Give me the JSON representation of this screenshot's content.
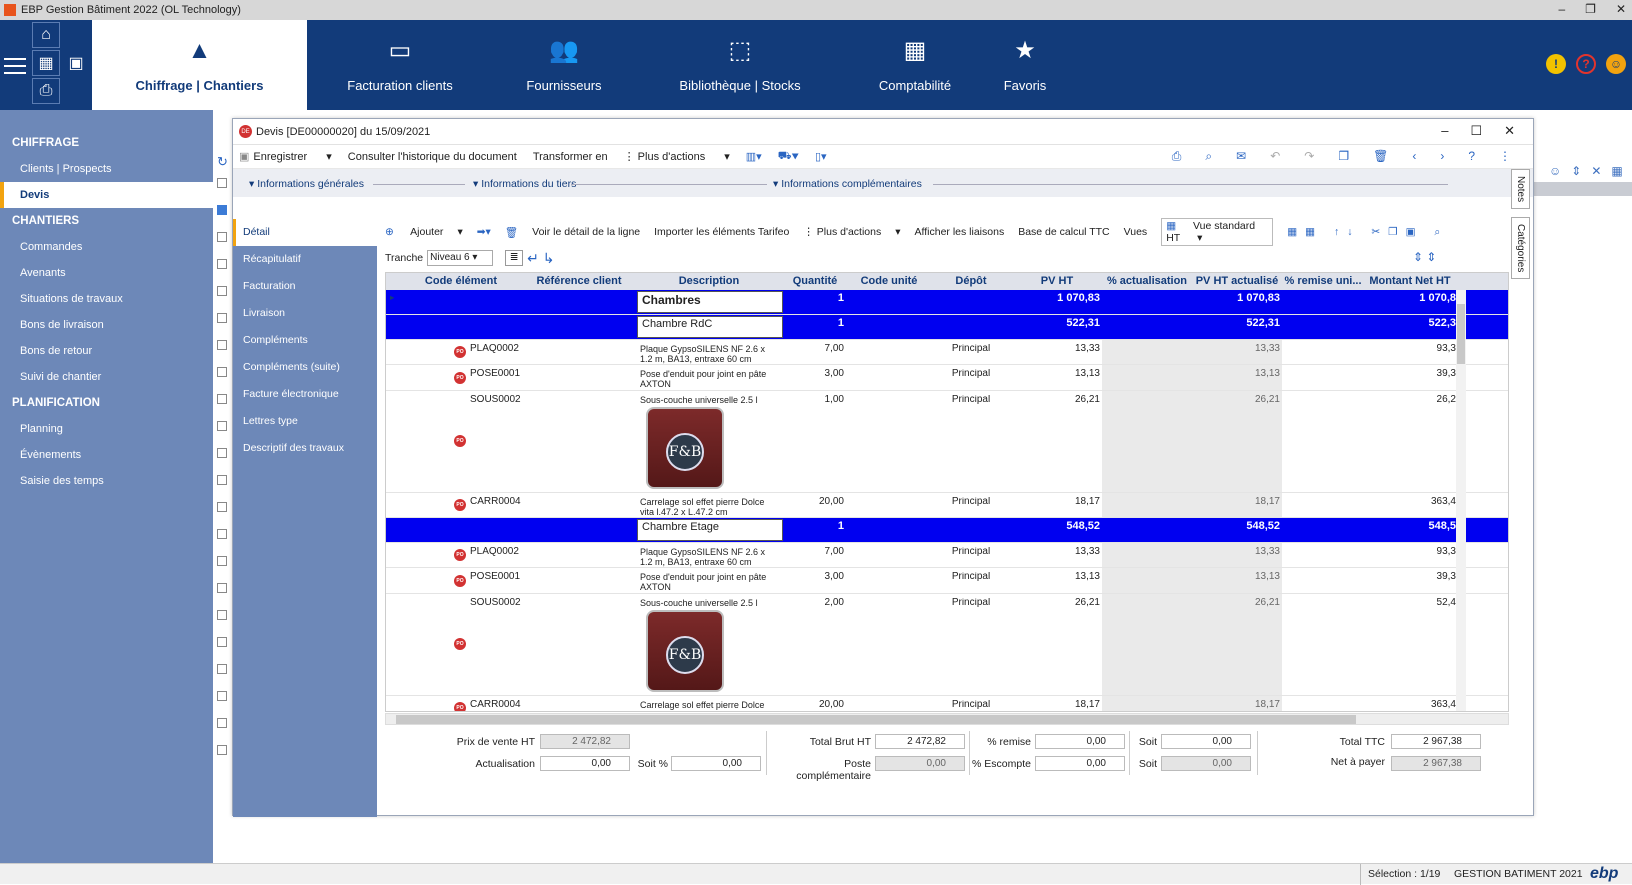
{
  "window": {
    "title": "EBP Gestion Bâtiment 2022 (OL Technology)"
  },
  "ribbon": {
    "tabs": [
      {
        "label": "Chiffrage | Chantiers",
        "icon": "cone-icon"
      },
      {
        "label": "Facturation clients",
        "icon": "card-icon"
      },
      {
        "label": "Fournisseurs",
        "icon": "users-icon"
      },
      {
        "label": "Bibliothèque | Stocks",
        "icon": "box-icon"
      },
      {
        "label": "Comptabilité",
        "icon": "calculator-icon"
      },
      {
        "label": "Favoris",
        "icon": "star-icon"
      }
    ]
  },
  "sidebar": {
    "sections": [
      {
        "title": "CHIFFRAGE",
        "items": [
          "Clients | Prospects",
          "Devis"
        ]
      },
      {
        "title": "CHANTIERS",
        "items": [
          "Commandes",
          "Avenants",
          "Situations de travaux",
          "Bons de livraison",
          "Bons de retour",
          "Suivi de chantier"
        ]
      },
      {
        "title": "PLANIFICATION",
        "items": [
          "Planning",
          "Évènements",
          "Saisie des temps"
        ]
      }
    ]
  },
  "doc": {
    "title": "Devis [DE00000020] du 15/09/2021",
    "toolbar": {
      "save": "Enregistrer",
      "history": "Consulter l'historique du document",
      "transform": "Transformer en",
      "more": "Plus d'actions"
    },
    "info": {
      "general": "Informations générales",
      "tiers": "Informations du tiers",
      "comp": "Informations complémentaires"
    },
    "lefttabs": [
      "Détail",
      "Récapitulatif",
      "Facturation",
      "Livraison",
      "Compléments",
      "Compléments (suite)",
      "Facture électronique",
      "Lettres type",
      "Descriptif des travaux"
    ],
    "sidetabs": [
      "Notes",
      "Catégories"
    ],
    "gridtoolbar": {
      "add": "Ajouter",
      "detail": "Voir le détail de la ligne",
      "import": "Importer les éléments Tarifeo",
      "more": "Plus d'actions",
      "links": "Afficher les liaisons",
      "ttc": "Base de calcul TTC",
      "views": "Vues",
      "view": "Vue standard HT"
    },
    "tranche": {
      "label": "Tranche",
      "value": "Niveau 6"
    },
    "columns": [
      "Code élément",
      "Référence client",
      "Description",
      "Quantité",
      "Code unité",
      "Dépôt",
      "PV HT",
      "% actualisation",
      "PV HT actualisé",
      "% remise uni...",
      "Montant Net HT"
    ],
    "rows": [
      {
        "type": "lvl",
        "desc": "Chambres",
        "qty": "1",
        "pv": "1 070,83",
        "pva": "1 070,83",
        "net": "1 070,8"
      },
      {
        "type": "lvl",
        "desc": "Chambre RdC",
        "qty": "1",
        "pv": "522,31",
        "pva": "522,31",
        "net": "522,3"
      },
      {
        "type": "item",
        "code": "PLAQ0002",
        "desc": "Plaque GypsoSILENS NF 2.6 x 1.2 m, BA13, entraxe 60 cm",
        "qty": "7,00",
        "depot": "Principal",
        "pv": "13,33",
        "pva": "13,33",
        "net": "93,3"
      },
      {
        "type": "item",
        "code": "POSE0001",
        "desc": "Pose d'enduit pour joint en pâte AXTON",
        "qty": "3,00",
        "depot": "Principal",
        "pv": "13,13",
        "pva": "13,13",
        "net": "39,3"
      },
      {
        "type": "img",
        "code": "SOUS0002",
        "desc": "Sous-couche universelle 2.5 l",
        "qty": "1,00",
        "depot": "Principal",
        "pv": "26,21",
        "pva": "26,21",
        "net": "26,2"
      },
      {
        "type": "item",
        "code": "CARR0004",
        "desc": "Carrelage sol effet pierre Dolce vita l.47.2 x L.47.2 cm",
        "qty": "20,00",
        "depot": "Principal",
        "pv": "18,17",
        "pva": "18,17",
        "net": "363,4"
      },
      {
        "type": "lvl",
        "desc": "Chambre Etage",
        "qty": "1",
        "pv": "548,52",
        "pva": "548,52",
        "net": "548,5"
      },
      {
        "type": "item",
        "code": "PLAQ0002",
        "desc": "Plaque GypsoSILENS NF 2.6 x 1.2 m, BA13, entraxe 60 cm",
        "qty": "7,00",
        "depot": "Principal",
        "pv": "13,33",
        "pva": "13,33",
        "net": "93,3"
      },
      {
        "type": "item",
        "code": "POSE0001",
        "desc": "Pose d'enduit pour joint en pâte AXTON",
        "qty": "3,00",
        "depot": "Principal",
        "pv": "13,13",
        "pva": "13,13",
        "net": "39,3"
      },
      {
        "type": "img",
        "code": "SOUS0002",
        "desc": "Sous-couche universelle 2.5 l",
        "qty": "2,00",
        "depot": "Principal",
        "pv": "26,21",
        "pva": "26,21",
        "net": "52,4"
      },
      {
        "type": "item",
        "code": "CARR0004",
        "desc": "Carrelage sol effet pierre Dolce vita l.47.2 x L.47.2 cm",
        "qty": "20,00",
        "depot": "Principal",
        "pv": "18,17",
        "pva": "18,17",
        "net": "363,4"
      }
    ],
    "paintlabel": "F&B",
    "totals": {
      "pv_label": "Prix de vente HT",
      "pv": "2 472,82",
      "act_label": "Actualisation",
      "act": "0,00",
      "soitp_label": "Soit %",
      "soitp": "0,00",
      "brut_label": "Total Brut HT",
      "brut": "2 472,82",
      "poste_label": "Poste complémentaire",
      "poste": "0,00",
      "remise_label": "% remise",
      "remise": "0,00",
      "esc_label": "% Escompte",
      "esc": "0,00",
      "soit1_label": "Soit",
      "soit1": "0,00",
      "soit2_label": "Soit",
      "soit2": "0,00",
      "ttc_label": "Total TTC",
      "ttc": "2 967,38",
      "nap_label": "Net à payer",
      "nap": "2 967,38"
    }
  },
  "status": {
    "selection": "Sélection : 1/19",
    "app": "GESTION BATIMENT 2021",
    "brand": "ebp"
  },
  "colors": {
    "ribbon": "#123b7a",
    "sidebar": "#6d88b8",
    "accent": "#f2a30f",
    "level_row": "#0000f0"
  }
}
